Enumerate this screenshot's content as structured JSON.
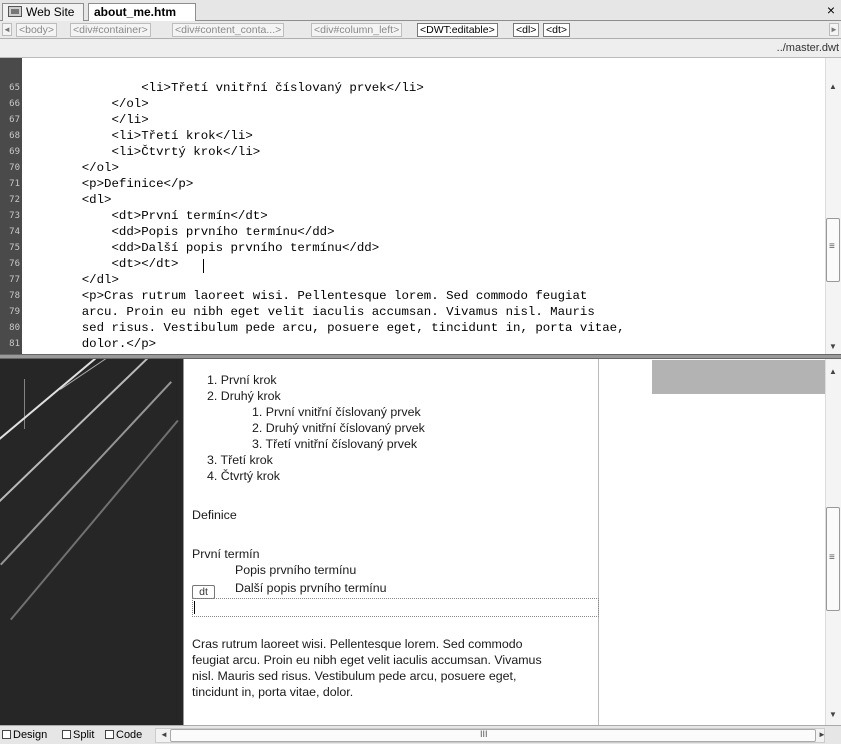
{
  "tabs": {
    "website_label": "Web Site",
    "file_label": "about_me.htm",
    "close": "×"
  },
  "tag_selector": {
    "left_arrow": "◄",
    "right_arrow": "►",
    "tags": [
      "<body>",
      "<div#container>",
      "<div#content_conta...>",
      "<div#column_left>",
      "<DWT:editable>",
      "<dl>",
      "<dt>"
    ]
  },
  "template_path": "../master.dwt",
  "code": {
    "line_numbers": [
      "65",
      "66",
      "67",
      "68",
      "69",
      "70",
      "71",
      "72",
      "73",
      "74",
      "75",
      "76",
      "77",
      "78",
      "79",
      "80",
      "81"
    ],
    "lines": [
      "            <li>Třetí vnitřní číslovaný prvek</li>",
      "        </ol>",
      "        </li>",
      "        <li>Třetí krok</li>",
      "        <li>Čtvrtý krok</li>",
      "    </ol>",
      "    <p>Definice</p>",
      "    <dl>",
      "        <dt>První termín</dt>",
      "        <dd>Popis prvního termínu</dd>",
      "        <dd>Další popis prvního termínu</dd>",
      "        <dt></dt>",
      "    </dl>",
      "    <p>Cras rutrum laoreet wisi. Pellentesque lorem. Sed commodo feugiat",
      "    arcu. Proin eu nibh eget velit iaculis accumsan. Vivamus nisl. Mauris",
      "    sed risus. Vestibulum pede arcu, posuere eget, tincidunt in, porta vitae,",
      "    dolor.</p>"
    ]
  },
  "design": {
    "ol_items": [
      "1.  První krok",
      "2.  Druhý krok"
    ],
    "nested_items": [
      "1.  První vnitřní číslovaný prvek",
      "2.  Druhý vnitřní číslovaný prvek",
      "3.  Třetí vnitřní číslovaný prvek"
    ],
    "ol_items_after": [
      "3.  Třetí krok",
      "4.  Čtvrtý krok"
    ],
    "definition_para": "Definice",
    "term1": "První termín",
    "desc1": "Popis prvního termínu",
    "desc2": "Další popis prvního termínu",
    "dt_badge": "dt",
    "paragraph_lines": [
      "Cras rutrum laoreet wisi. Pellentesque lorem. Sed commodo",
      "feugiat arcu. Proin eu nibh eget velit iaculis accumsan. Vivamus",
      "nisl. Mauris sed risus. Vestibulum pede arcu, posuere eget,",
      "tincidunt in, porta vitae, dolor."
    ]
  },
  "bottom": {
    "design_label": "Design",
    "split_label": "Split",
    "code_label": "Code",
    "grip": "III"
  }
}
